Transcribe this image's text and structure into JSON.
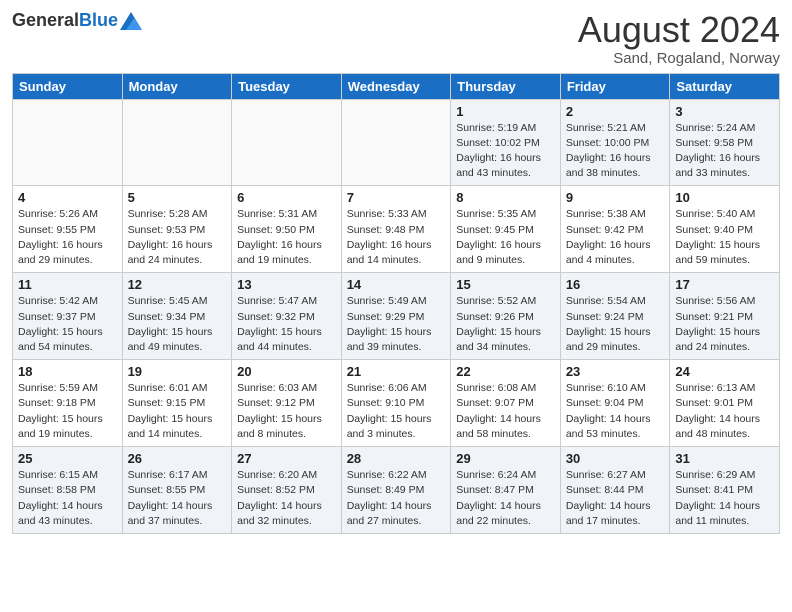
{
  "logo": {
    "general": "General",
    "blue": "Blue"
  },
  "title": {
    "month_year": "August 2024",
    "location": "Sand, Rogaland, Norway"
  },
  "headers": [
    "Sunday",
    "Monday",
    "Tuesday",
    "Wednesday",
    "Thursday",
    "Friday",
    "Saturday"
  ],
  "weeks": [
    [
      {
        "day": "",
        "info": ""
      },
      {
        "day": "",
        "info": ""
      },
      {
        "day": "",
        "info": ""
      },
      {
        "day": "",
        "info": ""
      },
      {
        "day": "1",
        "info": "Sunrise: 5:19 AM\nSunset: 10:02 PM\nDaylight: 16 hours\nand 43 minutes."
      },
      {
        "day": "2",
        "info": "Sunrise: 5:21 AM\nSunset: 10:00 PM\nDaylight: 16 hours\nand 38 minutes."
      },
      {
        "day": "3",
        "info": "Sunrise: 5:24 AM\nSunset: 9:58 PM\nDaylight: 16 hours\nand 33 minutes."
      }
    ],
    [
      {
        "day": "4",
        "info": "Sunrise: 5:26 AM\nSunset: 9:55 PM\nDaylight: 16 hours\nand 29 minutes."
      },
      {
        "day": "5",
        "info": "Sunrise: 5:28 AM\nSunset: 9:53 PM\nDaylight: 16 hours\nand 24 minutes."
      },
      {
        "day": "6",
        "info": "Sunrise: 5:31 AM\nSunset: 9:50 PM\nDaylight: 16 hours\nand 19 minutes."
      },
      {
        "day": "7",
        "info": "Sunrise: 5:33 AM\nSunset: 9:48 PM\nDaylight: 16 hours\nand 14 minutes."
      },
      {
        "day": "8",
        "info": "Sunrise: 5:35 AM\nSunset: 9:45 PM\nDaylight: 16 hours\nand 9 minutes."
      },
      {
        "day": "9",
        "info": "Sunrise: 5:38 AM\nSunset: 9:42 PM\nDaylight: 16 hours\nand 4 minutes."
      },
      {
        "day": "10",
        "info": "Sunrise: 5:40 AM\nSunset: 9:40 PM\nDaylight: 15 hours\nand 59 minutes."
      }
    ],
    [
      {
        "day": "11",
        "info": "Sunrise: 5:42 AM\nSunset: 9:37 PM\nDaylight: 15 hours\nand 54 minutes."
      },
      {
        "day": "12",
        "info": "Sunrise: 5:45 AM\nSunset: 9:34 PM\nDaylight: 15 hours\nand 49 minutes."
      },
      {
        "day": "13",
        "info": "Sunrise: 5:47 AM\nSunset: 9:32 PM\nDaylight: 15 hours\nand 44 minutes."
      },
      {
        "day": "14",
        "info": "Sunrise: 5:49 AM\nSunset: 9:29 PM\nDaylight: 15 hours\nand 39 minutes."
      },
      {
        "day": "15",
        "info": "Sunrise: 5:52 AM\nSunset: 9:26 PM\nDaylight: 15 hours\nand 34 minutes."
      },
      {
        "day": "16",
        "info": "Sunrise: 5:54 AM\nSunset: 9:24 PM\nDaylight: 15 hours\nand 29 minutes."
      },
      {
        "day": "17",
        "info": "Sunrise: 5:56 AM\nSunset: 9:21 PM\nDaylight: 15 hours\nand 24 minutes."
      }
    ],
    [
      {
        "day": "18",
        "info": "Sunrise: 5:59 AM\nSunset: 9:18 PM\nDaylight: 15 hours\nand 19 minutes."
      },
      {
        "day": "19",
        "info": "Sunrise: 6:01 AM\nSunset: 9:15 PM\nDaylight: 15 hours\nand 14 minutes."
      },
      {
        "day": "20",
        "info": "Sunrise: 6:03 AM\nSunset: 9:12 PM\nDaylight: 15 hours\nand 8 minutes."
      },
      {
        "day": "21",
        "info": "Sunrise: 6:06 AM\nSunset: 9:10 PM\nDaylight: 15 hours\nand 3 minutes."
      },
      {
        "day": "22",
        "info": "Sunrise: 6:08 AM\nSunset: 9:07 PM\nDaylight: 14 hours\nand 58 minutes."
      },
      {
        "day": "23",
        "info": "Sunrise: 6:10 AM\nSunset: 9:04 PM\nDaylight: 14 hours\nand 53 minutes."
      },
      {
        "day": "24",
        "info": "Sunrise: 6:13 AM\nSunset: 9:01 PM\nDaylight: 14 hours\nand 48 minutes."
      }
    ],
    [
      {
        "day": "25",
        "info": "Sunrise: 6:15 AM\nSunset: 8:58 PM\nDaylight: 14 hours\nand 43 minutes."
      },
      {
        "day": "26",
        "info": "Sunrise: 6:17 AM\nSunset: 8:55 PM\nDaylight: 14 hours\nand 37 minutes."
      },
      {
        "day": "27",
        "info": "Sunrise: 6:20 AM\nSunset: 8:52 PM\nDaylight: 14 hours\nand 32 minutes."
      },
      {
        "day": "28",
        "info": "Sunrise: 6:22 AM\nSunset: 8:49 PM\nDaylight: 14 hours\nand 27 minutes."
      },
      {
        "day": "29",
        "info": "Sunrise: 6:24 AM\nSunset: 8:47 PM\nDaylight: 14 hours\nand 22 minutes."
      },
      {
        "day": "30",
        "info": "Sunrise: 6:27 AM\nSunset: 8:44 PM\nDaylight: 14 hours\nand 17 minutes."
      },
      {
        "day": "31",
        "info": "Sunrise: 6:29 AM\nSunset: 8:41 PM\nDaylight: 14 hours\nand 11 minutes."
      }
    ]
  ]
}
